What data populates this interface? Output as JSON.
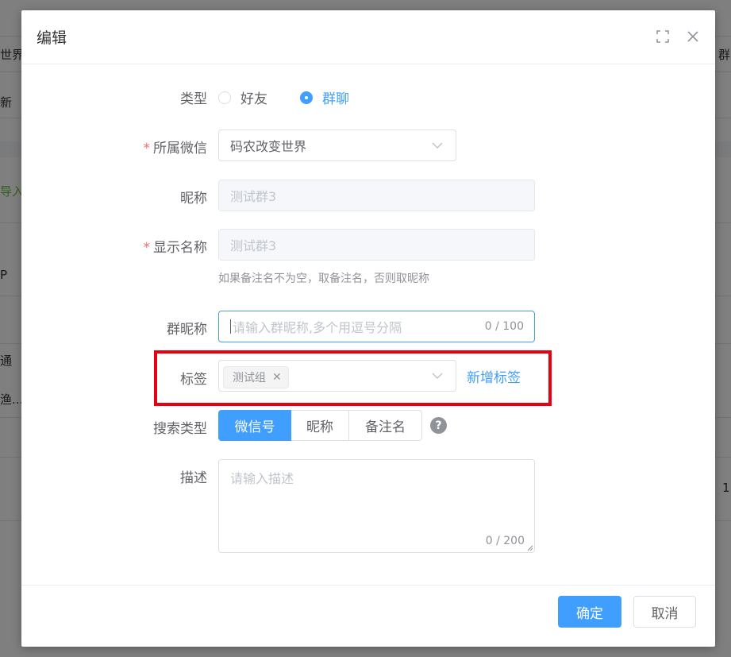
{
  "background": {
    "fragments": [
      "世界",
      "新",
      "导入",
      "P",
      "通",
      "渔...",
      "群",
      "1"
    ]
  },
  "dialog": {
    "title": "编辑",
    "form": {
      "type": {
        "label": "类型",
        "options": [
          "好友",
          "群聊"
        ],
        "selected": "群聊"
      },
      "wechat": {
        "label": "所属微信",
        "required_mark": "*",
        "value": "码农改变世界"
      },
      "nickname": {
        "label": "昵称",
        "value": "测试群3"
      },
      "display_name": {
        "label": "显示名称",
        "required_mark": "*",
        "value": "测试群3",
        "hint": "如果备注名不为空，取备注名，否则取昵称"
      },
      "group_nickname": {
        "label": "群昵称",
        "placeholder": "请输入群昵称,多个用逗号分隔",
        "counter": "0 / 100"
      },
      "tags": {
        "label": "标签",
        "tag": "测试组",
        "add_link": "新增标签"
      },
      "search_type": {
        "label": "搜索类型",
        "options": [
          "微信号",
          "昵称",
          "备注名"
        ],
        "selected": "微信号",
        "help_icon": "question-circle-icon"
      },
      "description": {
        "label": "描述",
        "placeholder": "请输入描述",
        "counter": "0 / 200"
      }
    },
    "footer": {
      "confirm": "确定",
      "cancel": "取消"
    }
  },
  "colors": {
    "primary": "#409eff",
    "required": "#f56c6c",
    "highlight_box": "#e60012"
  }
}
